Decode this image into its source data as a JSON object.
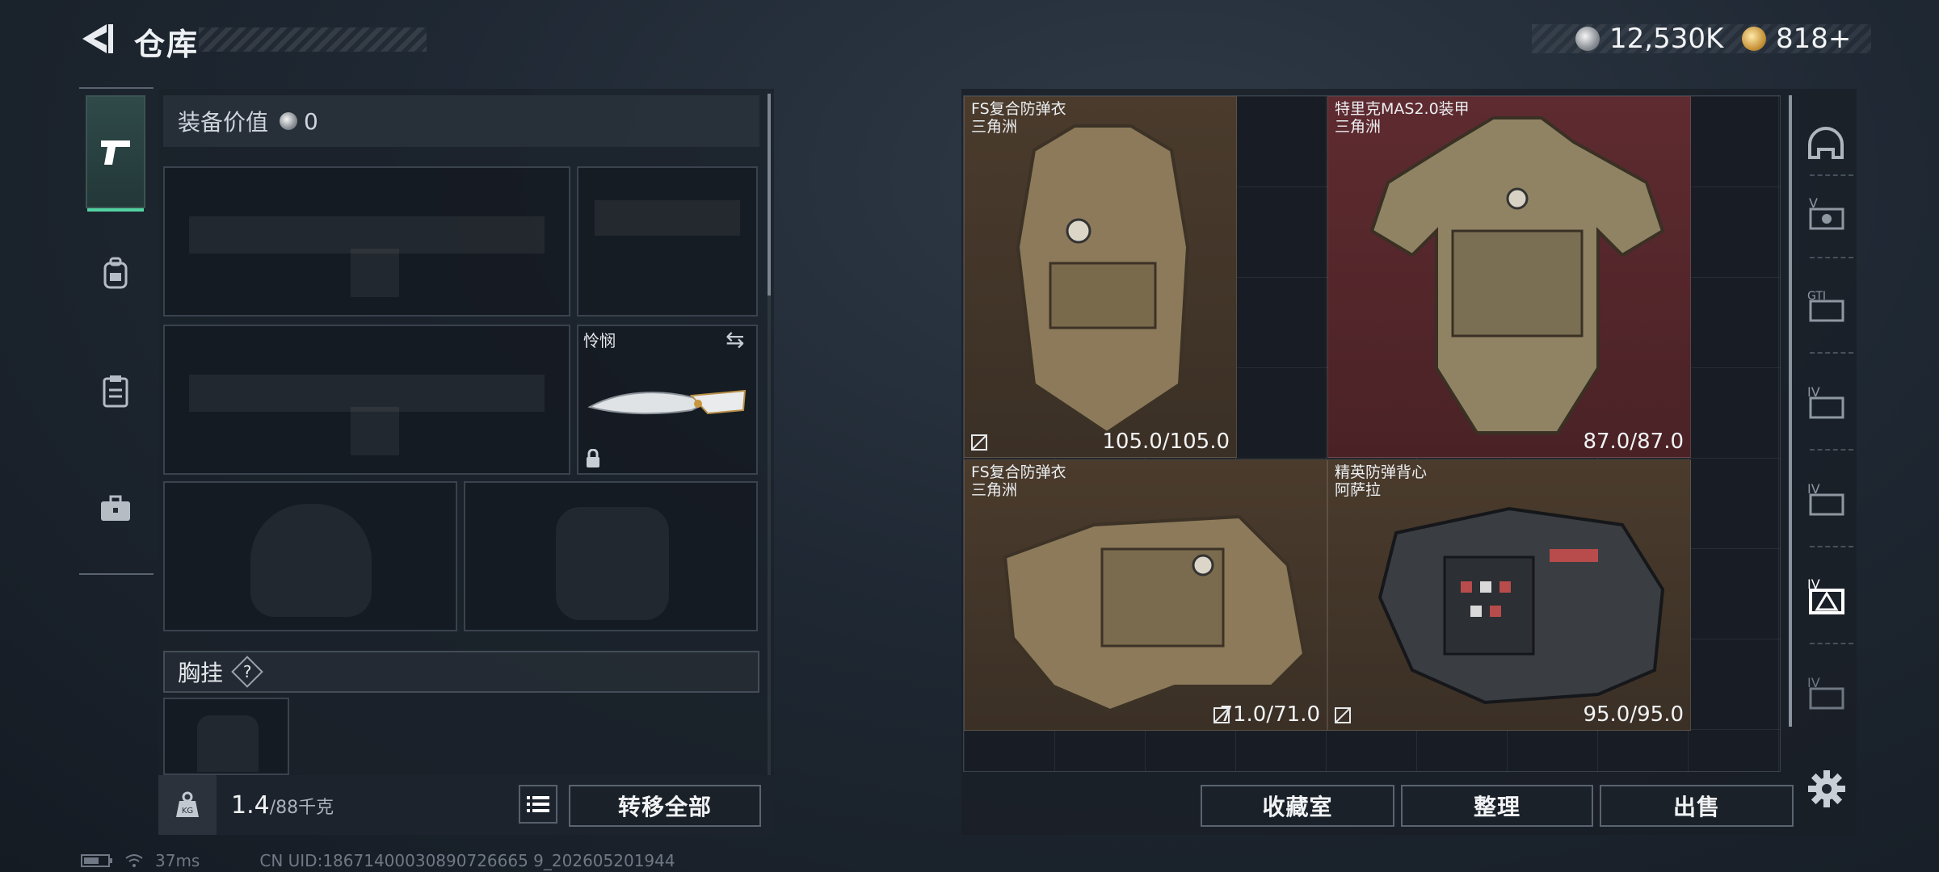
{
  "header": {
    "title": "仓库",
    "silver_amount": "12,530K",
    "gold_amount": "818+"
  },
  "left_tabs": [
    {
      "name": "weapons",
      "icon": "pistol-icon",
      "active": true
    },
    {
      "name": "backpack",
      "icon": "backpack-icon",
      "active": false
    },
    {
      "name": "chest-rig",
      "icon": "clipboard-icon",
      "active": false
    },
    {
      "name": "case",
      "icon": "briefcase-icon",
      "active": false
    }
  ],
  "loadout": {
    "value_label": "装备价值",
    "value_amount": "0",
    "melee_name": "怜悯",
    "chest_rig_label": "胸挂",
    "help_label": "?"
  },
  "bottom_left": {
    "weight_current": "1.4",
    "weight_max": "/88千克",
    "transfer_all": "转移全部"
  },
  "items": [
    {
      "name": "FS复合防弹衣",
      "source": "三角洲",
      "durability": "105.0/105.0",
      "rarity_color": "#4a3b2c"
    },
    {
      "name": "特里克MAS2.0装甲",
      "source": "三角洲",
      "durability": "87.0/87.0",
      "rarity_color": "#5e2b30"
    },
    {
      "name": "FS复合防弹衣",
      "source": "三角洲",
      "durability": "71.0/71.0",
      "rarity_color": "#4a3b2c"
    },
    {
      "name": "精英防弹背心",
      "source": "阿萨拉",
      "durability": "95.0/95.0",
      "rarity_color": "#4a3b2c"
    }
  ],
  "right_actions": {
    "collection": "收藏室",
    "sort": "整理",
    "sell": "出售"
  },
  "categories": [
    {
      "icon": "helmet-icon",
      "tier": ""
    },
    {
      "icon": "armor-v-icon",
      "tier": "V"
    },
    {
      "icon": "armor-gti-icon",
      "tier": "GTI"
    },
    {
      "icon": "armor-iv-a-icon",
      "tier": "IV"
    },
    {
      "icon": "armor-iv-b-icon",
      "tier": "IV"
    },
    {
      "icon": "armor-iv-active-icon",
      "tier": "IV"
    },
    {
      "icon": "armor-iv-c-icon",
      "tier": "IV"
    }
  ],
  "footer": {
    "ping": "37ms",
    "uid": "CN UID:18671400030890726665 9_202605201944"
  }
}
